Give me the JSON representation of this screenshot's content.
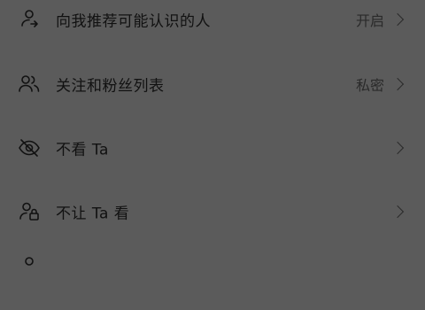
{
  "settings": {
    "items": [
      {
        "label": "向我推荐可能认识的人",
        "value": "开启",
        "icon": "people-suggest-icon"
      },
      {
        "label": "关注和粉丝列表",
        "value": "私密",
        "icon": "followers-icon"
      },
      {
        "label": "不看 Ta",
        "value": "",
        "icon": "eye-off-icon"
      },
      {
        "label": "不让 Ta 看",
        "value": "",
        "icon": "user-lock-icon"
      }
    ]
  }
}
